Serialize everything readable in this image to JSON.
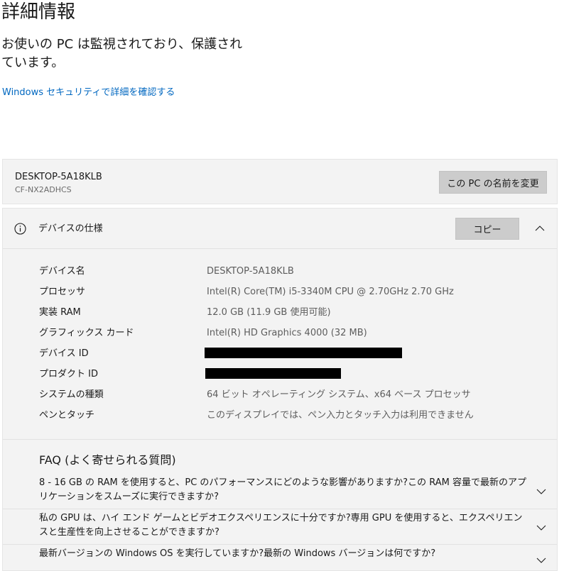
{
  "header": {
    "title": "詳細情報",
    "status": "お使いの PC は監視されており、保護されています。",
    "security_link": "Windows セキュリティで詳細を確認する"
  },
  "device": {
    "name": "DESKTOP-5A18KLB",
    "model": "CF-NX2ADHCS",
    "rename_label": "この PC の名前を変更"
  },
  "specs": {
    "title": "デバイスの仕様",
    "copy_label": "コピー",
    "rows": [
      {
        "label": "デバイス名",
        "value": "DESKTOP-5A18KLB"
      },
      {
        "label": "プロセッサ",
        "value": "Intel(R) Core(TM) i5-3340M CPU @ 2.70GHz   2.70 GHz"
      },
      {
        "label": "実装 RAM",
        "value": "12.0 GB (11.9 GB 使用可能)"
      },
      {
        "label": "グラフィックス カード",
        "value": "Intel(R) HD Graphics 4000 (32 MB)"
      },
      {
        "label": "デバイス ID",
        "value": ""
      },
      {
        "label": "プロダクト ID",
        "value": ""
      },
      {
        "label": "システムの種類",
        "value": "64 ビット オペレーティング システム、x64 ベース プロセッサ"
      },
      {
        "label": "ペンとタッチ",
        "value": "このディスプレイでは、ペン入力とタッチ入力は利用できません"
      }
    ]
  },
  "faq": {
    "title": "FAQ (よく寄せられる質問)",
    "items": [
      {
        "question": "8 - 16 GB の RAM を使用すると、PC のパフォーマンスにどのような影響がありますか?この RAM 容量で最新のアプリケーションをスムーズに実行できますか?"
      },
      {
        "question": "私の GPU は、ハイ エンド ゲームとビデオエクスペリエンスに十分ですか?専用 GPU を使用すると、エクスペリエンスと生産性を向上させることができますか?"
      },
      {
        "question": "最新バージョンの Windows OS を実行していますか?最新の Windows バージョンは何ですか?"
      }
    ]
  },
  "icons": {
    "info": "info-icon",
    "collapse": "chevron-up-icon",
    "expand": "chevron-down-icon"
  },
  "colors": {
    "link": "#0067c0",
    "card_background": "#f3f3f3",
    "button_background": "#cccccc"
  }
}
